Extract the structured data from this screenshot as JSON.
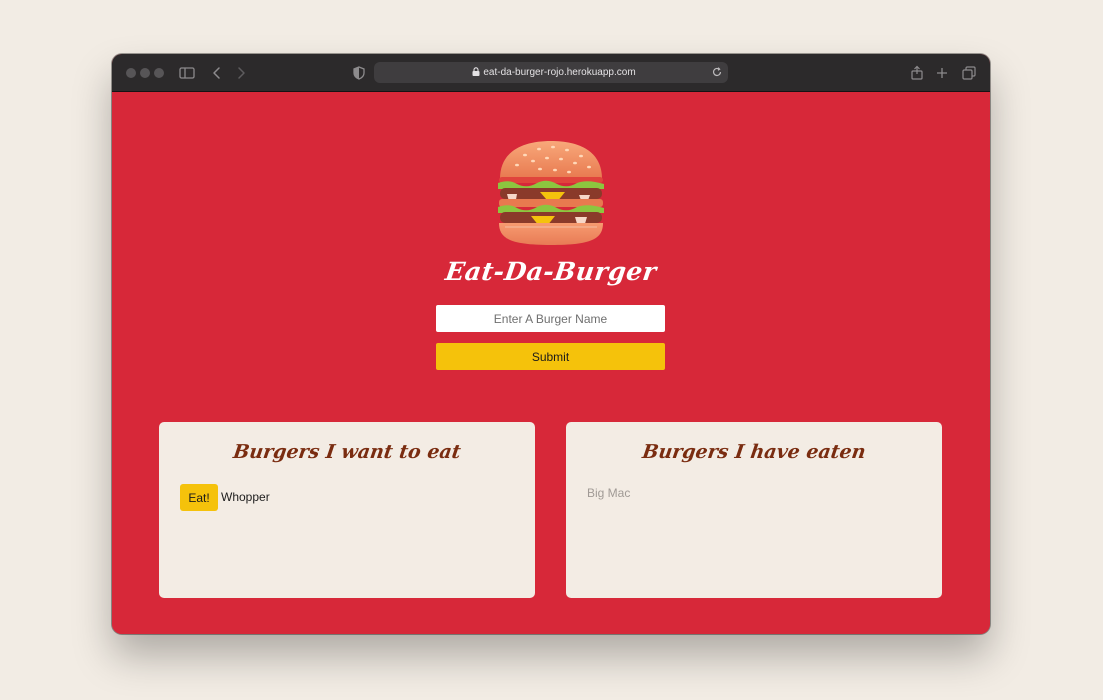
{
  "browser": {
    "url": "eat-da-burger-rojo.herokuapp.com"
  },
  "page": {
    "title": "Eat-Da-Burger",
    "input_placeholder": "Enter A Burger Name",
    "submit_label": "Submit"
  },
  "to_eat": {
    "heading": "Burgers I want to eat",
    "eat_label": "Eat!",
    "items": [
      {
        "name": "Whopper"
      }
    ]
  },
  "eaten": {
    "heading": "Burgers I have eaten",
    "items": [
      {
        "name": "Big Mac"
      }
    ]
  },
  "colors": {
    "page_background": "#f2ece4",
    "content_red": "#d72839",
    "button_yellow": "#f5c20b",
    "card_background": "#f3ece4",
    "heading_brown": "#7a2c10",
    "eaten_text_gray": "#a09a95"
  },
  "icons": {
    "toolbar": [
      "sidebar-icon",
      "back-icon",
      "forward-icon",
      "privacy-shield-icon",
      "lock-icon",
      "reload-icon",
      "share-icon",
      "new-tab-icon",
      "tab-overview-icon"
    ],
    "logo": "burger-icon"
  }
}
